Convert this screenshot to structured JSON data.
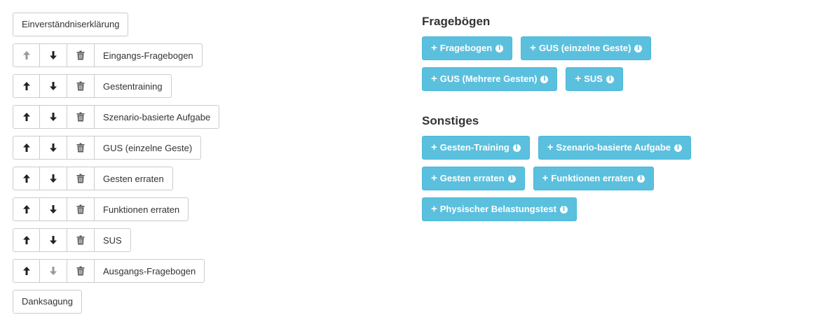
{
  "colors": {
    "info": "#5bc0de",
    "border": "#cccccc",
    "text": "#333333",
    "disabled_arrow": "#999999"
  },
  "left": {
    "intro": "Einverständniserklärung",
    "steps": [
      {
        "label": "Eingangs-Fragebogen",
        "up_disabled": true,
        "down_disabled": false
      },
      {
        "label": "Gestentraining",
        "up_disabled": false,
        "down_disabled": false
      },
      {
        "label": "Szenario-basierte Aufgabe",
        "up_disabled": false,
        "down_disabled": false
      },
      {
        "label": "GUS (einzelne Geste)",
        "up_disabled": false,
        "down_disabled": false
      },
      {
        "label": "Gesten erraten",
        "up_disabled": false,
        "down_disabled": false
      },
      {
        "label": "Funktionen erraten",
        "up_disabled": false,
        "down_disabled": false
      },
      {
        "label": "SUS",
        "up_disabled": false,
        "down_disabled": false
      },
      {
        "label": "Ausgangs-Fragebogen",
        "up_disabled": false,
        "down_disabled": true
      }
    ],
    "outro": "Danksagung"
  },
  "right": {
    "fragebogen_title": "Fragebögen",
    "fragebogen_buttons": [
      "Fragebogen",
      "GUS (einzelne Geste)",
      "GUS (Mehrere Gesten)",
      "SUS"
    ],
    "sonstiges_title": "Sonstiges",
    "sonstiges_buttons": [
      "Gesten-Training",
      "Szenario-basierte Aufgabe",
      "Gesten erraten",
      "Funktionen erraten",
      "Physischer Belastungstest"
    ],
    "plus_symbol": "+",
    "info_symbol": "i"
  }
}
